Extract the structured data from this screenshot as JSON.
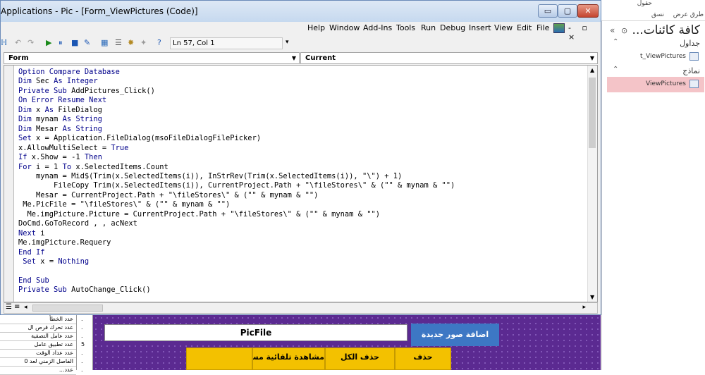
{
  "vba": {
    "title": "Applications - Pic - [Form_ViewPictures (Code)]",
    "window_buttons": {
      "minimize": "▭",
      "restore": "▢",
      "close": "✕"
    },
    "menus": [
      "Help",
      "Window",
      "Add-Ins",
      "Tools",
      "Run",
      "Debug",
      "Insert",
      "View",
      "Edit",
      "File"
    ],
    "mdi_controls": "- ▫ ×",
    "position": "Ln 57, Col 1",
    "object_combo": "Form",
    "procedure_combo": "Current",
    "code_lines": [
      "Option Compare Database",
      "Dim Sec As Integer",
      "Private Sub AddPictures_Click()",
      "On Error Resume Next",
      "Dim x As FileDialog",
      "Dim mynam As String",
      "Dim Mesar As String",
      "Set x = Application.FileDialog(msoFileDialogFilePicker)",
      "x.AllowMultiSelect = True",
      "If x.Show = -1 Then",
      "For i = 1 To x.SelectedItems.Count",
      "    mynam = Mid$(Trim(x.SelectedItems(i)), InStrRev(Trim(x.SelectedItems(i)), \"\\\") + 1)",
      "        FileCopy Trim(x.SelectedItems(i)), CurrentProject.Path + \"\\fileStores\\\" & (\"\" & mynam & \"\")",
      "    Mesar = CurrentProject.Path + \"\\fileStores\\\" & (\"\" & mynam & \"\")",
      " Me.PicFile = \"\\fileStores\\\" & (\"\" & mynam & \"\")",
      "  Me.imgPicture.Picture = CurrentProject.Path + \"\\fileStores\\\" & (\"\" & mynam & \"\")",
      "DoCmd.GoToRecord , , acNext",
      "Next i",
      "Me.imgPicture.Requery",
      "End If",
      " Set x = Nothing",
      "",
      "End Sub",
      "Private Sub AutoChange_Click()"
    ]
  },
  "nav": {
    "ribbon_label_1": "طرق عرض",
    "ribbon_label_2": "نسق",
    "ribbon_label_3": "حقول",
    "title": "كافة كائنات...",
    "groups": [
      {
        "label": "جداول",
        "items": [
          "t_ViewPictures"
        ]
      },
      {
        "label": "نماذج",
        "items": [
          "ViewPictures"
        ]
      }
    ]
  },
  "form": {
    "list_rows": [
      "عدد الخطأ",
      "عدد تحرك قرص ال",
      "عدد عامل التصفية",
      "عدد تطبيق عامل",
      "عدد عداد الوقت",
      "الفاصل الزمني لعد 0",
      "عدد..."
    ],
    "mid_values": [
      ".",
      ".",
      ".",
      "5",
      ".",
      ".",
      "."
    ],
    "pic_field": "PicFile",
    "add_button": "اضافة صور جديدة",
    "buttons": [
      "حذف",
      "حذف الكل",
      "مشاهدة تلقائية مستمر"
    ]
  }
}
